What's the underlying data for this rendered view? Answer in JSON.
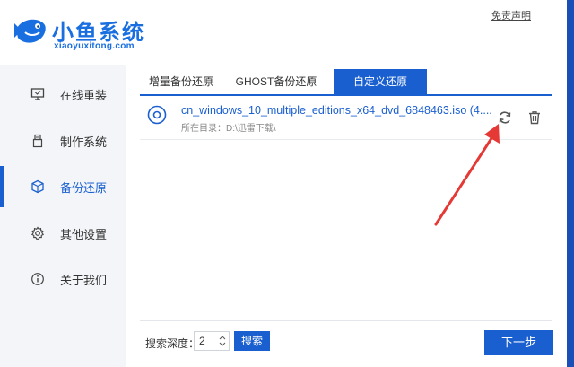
{
  "header": {
    "logo_title": "小鱼系统",
    "logo_subtitle": "xiaoyuxitong.com",
    "disclaimer": "免责声明"
  },
  "sidebar": {
    "items": [
      {
        "label": "在线重装",
        "icon": "monitor-icon"
      },
      {
        "label": "制作系统",
        "icon": "usb-icon"
      },
      {
        "label": "备份还原",
        "icon": "cube-icon",
        "active": true
      },
      {
        "label": "其他设置",
        "icon": "gear-icon"
      },
      {
        "label": "关于我们",
        "icon": "info-icon"
      }
    ]
  },
  "tabs": [
    {
      "label": "增量备份还原"
    },
    {
      "label": "GHOST备份还原"
    },
    {
      "label": "自定义还原",
      "active": true
    }
  ],
  "file": {
    "name": "cn_windows_10_multiple_editions_x64_dvd_6848463.iso (4....",
    "dir_label": "所在目录：D:\\迅雷下载\\"
  },
  "footer": {
    "depth_label": "搜索深度：",
    "depth_value": "2",
    "search_label": "搜索",
    "next_label": "下一步"
  },
  "colors": {
    "accent": "#1a5fd0",
    "annotation_arrow": "#e53935"
  }
}
